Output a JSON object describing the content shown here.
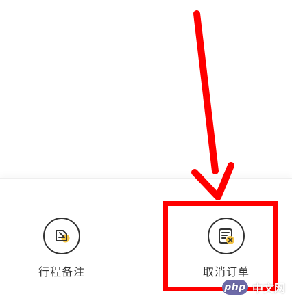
{
  "actions": {
    "trip_note": {
      "label": "行程备注",
      "icon": "edit-note-icon"
    },
    "cancel_order": {
      "label": "取消订单",
      "icon": "cancel-order-icon"
    }
  },
  "watermark": {
    "badge": "php",
    "text": "中文网"
  },
  "colors": {
    "highlight": "#ff0000",
    "icon_accent": "#f5c542",
    "text": "#333333"
  }
}
